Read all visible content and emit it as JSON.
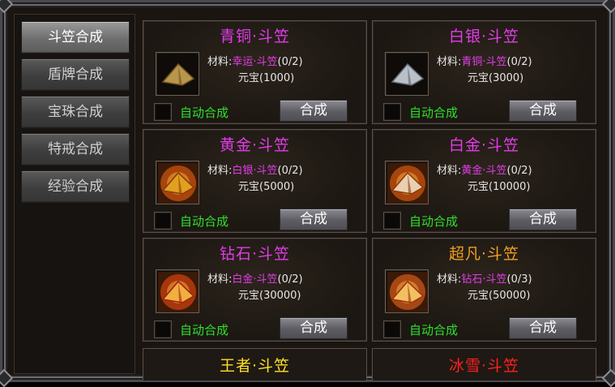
{
  "colors": {
    "magenta": "#e23ce8",
    "orange": "#f0a020",
    "yellow": "#ffe020",
    "red": "#ff2020",
    "green": "#2ee02e"
  },
  "sidebar": {
    "tabs": [
      {
        "label": "斗笠合成",
        "active": true
      },
      {
        "label": "盾牌合成",
        "active": false
      },
      {
        "label": "宝珠合成",
        "active": false
      },
      {
        "label": "特戒合成",
        "active": false
      },
      {
        "label": "经验合成",
        "active": false
      }
    ]
  },
  "common": {
    "material_prefix": "材料:",
    "auto_label": "自动合成",
    "synth_label": "合成"
  },
  "cards": [
    {
      "title": "青铜·斗笠",
      "title_color": "#e23ce8",
      "material": "幸运·斗笠",
      "material_count": "(0/2)",
      "cost": "元宝(1000)",
      "icon": "bronze-hat-icon"
    },
    {
      "title": "白银·斗笠",
      "title_color": "#e23ce8",
      "material": "青铜·斗笠",
      "material_count": "(0/2)",
      "cost": "元宝(3000)",
      "icon": "silver-hat-icon"
    },
    {
      "title": "黄金·斗笠",
      "title_color": "#e23ce8",
      "material": "白银·斗笠",
      "material_count": "(0/2)",
      "cost": "元宝(5000)",
      "icon": "gold-hat-icon"
    },
    {
      "title": "白金·斗笠",
      "title_color": "#e23ce8",
      "material": "黄金·斗笠",
      "material_count": "(0/2)",
      "cost": "元宝(10000)",
      "icon": "platinum-hat-icon"
    },
    {
      "title": "钻石·斗笠",
      "title_color": "#e23ce8",
      "material": "白金·斗笠",
      "material_count": "(0/2)",
      "cost": "元宝(30000)",
      "icon": "diamond-hat-icon"
    },
    {
      "title": "超凡·斗笠",
      "title_color": "#f0a020",
      "material": "钻石·斗笠",
      "material_count": "(0/3)",
      "cost": "元宝(50000)",
      "icon": "transcendent-hat-icon"
    }
  ],
  "partial_cards": [
    {
      "title": "王者·斗笠",
      "title_color": "#ffe020"
    },
    {
      "title": "冰雪·斗笠",
      "title_color": "#ff2020"
    }
  ]
}
